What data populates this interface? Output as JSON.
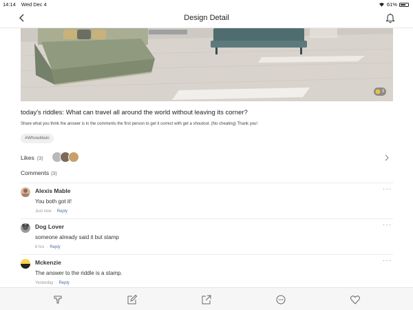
{
  "status_bar": {
    "time": "14:14",
    "date": "Wed Dec 4",
    "battery": "61%"
  },
  "nav": {
    "title": "Design Detail"
  },
  "hero": {
    "badge_count": "3"
  },
  "post": {
    "title": "today's riddles: What can travel all around the world without leaving its corner?",
    "subtitle": "Share what you think the answer is in the comments the first person to get it correct with get a shoutout. (No cheating) Thank you!",
    "tag": "#Whowillwin"
  },
  "likes": {
    "label": "Likes",
    "count": "(3)"
  },
  "comments_section": {
    "label": "Comments",
    "count": "(3)"
  },
  "comments": [
    {
      "name": "Alexis Mable",
      "text": "You both got it!",
      "time": "Just now",
      "reply": "Reply"
    },
    {
      "name": "Dog Lover",
      "text": "someone already said it but stamp",
      "time": "6 hrs",
      "reply": "Reply"
    },
    {
      "name": "Mckenzie",
      "text": "The answer to the riddle is a stamp.",
      "time": "Yesterday",
      "reply": "Reply"
    }
  ],
  "more_glyph": "···",
  "toolbar": [
    "paintbrush-icon",
    "edit-icon",
    "share-icon",
    "comment-icon",
    "heart-icon"
  ],
  "colors": {
    "reply_link": "#4a6fa5",
    "toolbar_bg": "#f6f6f6",
    "floor": "#d9d3cd",
    "sofa": "#4f6d6e",
    "bed": "#8f9a7e",
    "badge": "#e8c24a"
  }
}
